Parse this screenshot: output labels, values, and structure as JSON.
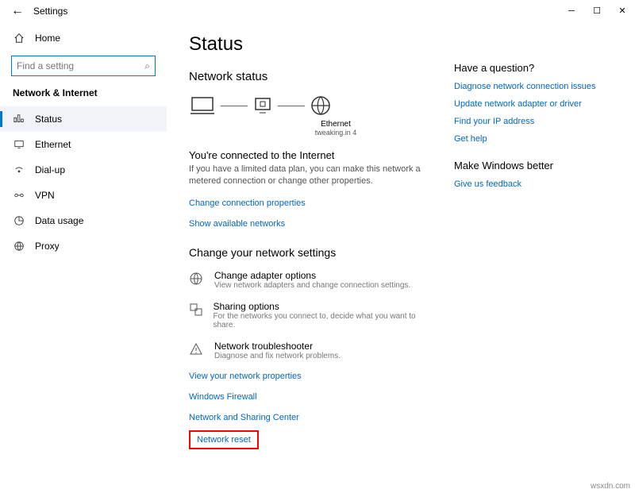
{
  "titlebar": {
    "title": "Settings"
  },
  "sidebar": {
    "home": "Home",
    "search_placeholder": "Find a setting",
    "group": "Network & Internet",
    "items": [
      {
        "label": "Status"
      },
      {
        "label": "Ethernet"
      },
      {
        "label": "Dial-up"
      },
      {
        "label": "VPN"
      },
      {
        "label": "Data usage"
      },
      {
        "label": "Proxy"
      }
    ]
  },
  "page": {
    "title": "Status",
    "netstatus": "Network status",
    "eth_label": "Ethernet",
    "eth_sub": "tweaking.in 4",
    "connected": "You're connected to the Internet",
    "connected_desc": "If you have a limited data plan, you can make this network a metered connection or change other properties.",
    "link_ccp": "Change connection properties",
    "link_san": "Show available networks",
    "cyns": "Change your network settings",
    "opts": [
      {
        "title": "Change adapter options",
        "desc": "View network adapters and change connection settings."
      },
      {
        "title": "Sharing options",
        "desc": "For the networks you connect to, decide what you want to share."
      },
      {
        "title": "Network troubleshooter",
        "desc": "Diagnose and fix network problems."
      }
    ],
    "link_vnp": "View your network properties",
    "link_wf": "Windows Firewall",
    "link_nsc": "Network and Sharing Center",
    "link_nr": "Network reset"
  },
  "right": {
    "q_title": "Have a question?",
    "q_links": [
      "Diagnose network connection issues",
      "Update network adapter or driver",
      "Find your IP address",
      "Get help"
    ],
    "b_title": "Make Windows better",
    "b_link": "Give us feedback"
  },
  "watermark": "wsxdn.com"
}
